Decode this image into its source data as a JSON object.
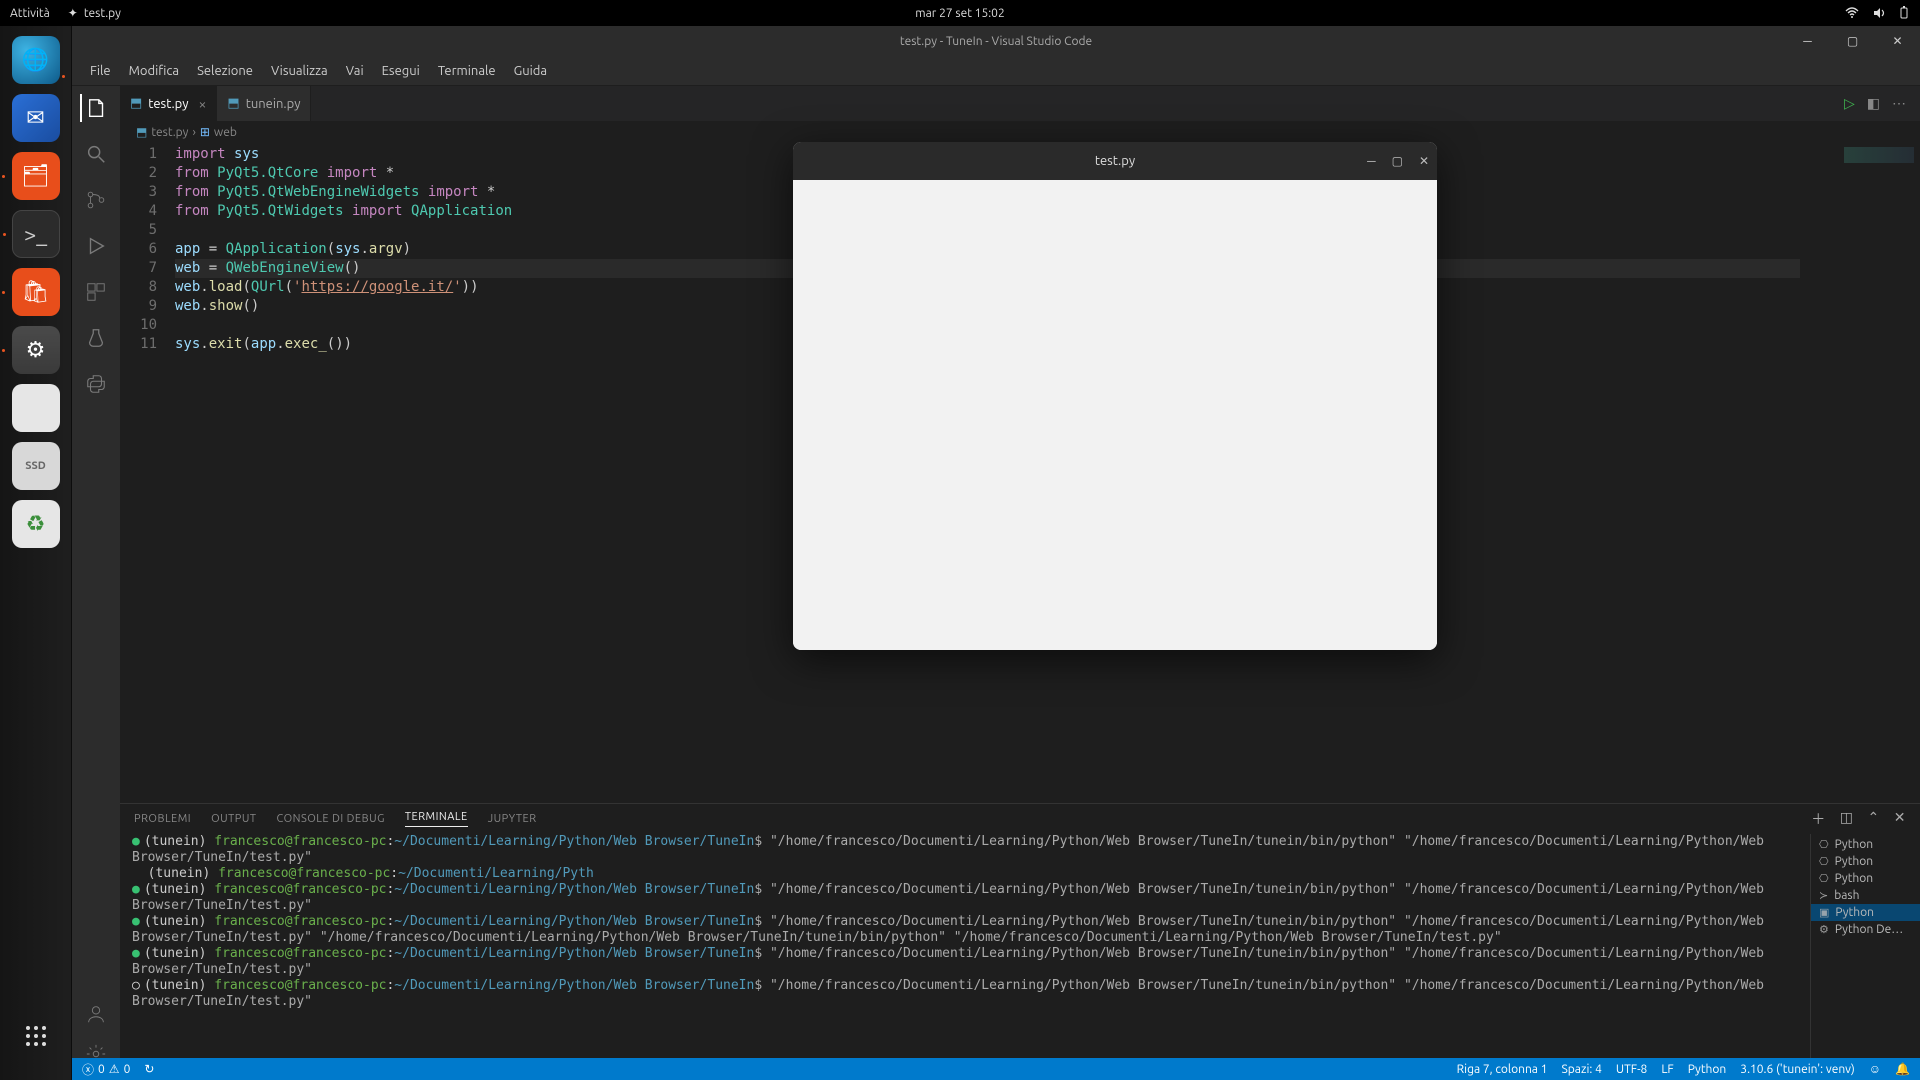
{
  "gnome": {
    "activities": "Attività",
    "task": "test.py",
    "datetime": "mar 27 set  15:02"
  },
  "dock_labels": {
    "ssd": "SSD"
  },
  "vscode": {
    "title": "test.py - TuneIn - Visual Studio Code",
    "menu": [
      "File",
      "Modifica",
      "Selezione",
      "Visualizza",
      "Vai",
      "Esegui",
      "Terminale",
      "Guida"
    ],
    "tabs": [
      {
        "label": "test.py",
        "active": true
      },
      {
        "label": "tunein.py",
        "active": false
      }
    ],
    "breadcrumb": {
      "file": "test.py",
      "symbol": "web"
    },
    "active_line": 7,
    "code": [
      {
        "n": 1,
        "raw": "import sys"
      },
      {
        "n": 2,
        "raw": "from PyQt5.QtCore import *"
      },
      {
        "n": 3,
        "raw": "from PyQt5.QtWebEngineWidgets import *"
      },
      {
        "n": 4,
        "raw": "from PyQt5.QtWidgets import QApplication"
      },
      {
        "n": 5,
        "raw": ""
      },
      {
        "n": 6,
        "raw": "app = QApplication(sys.argv)"
      },
      {
        "n": 7,
        "raw": "web = QWebEngineView()"
      },
      {
        "n": 8,
        "raw": "web.load(QUrl('https://google.it/'))"
      },
      {
        "n": 9,
        "raw": "web.show()"
      },
      {
        "n": 10,
        "raw": ""
      },
      {
        "n": 11,
        "raw": "sys.exit(app.exec_())"
      }
    ],
    "panel": {
      "tabs": [
        "PROBLEMI",
        "OUTPUT",
        "CONSOLE DI DEBUG",
        "TERMINALE",
        "JUPYTER"
      ],
      "active_tab": "TERMINALE",
      "terminal_sessions": [
        {
          "label": "Python",
          "icon": "snake"
        },
        {
          "label": "Python",
          "icon": "snake"
        },
        {
          "label": "Python",
          "icon": "snake"
        },
        {
          "label": "bash",
          "icon": "bash"
        },
        {
          "label": "Python",
          "icon": "term",
          "active": true
        },
        {
          "label": "Python De…",
          "icon": "gear"
        }
      ],
      "terminal_lines": [
        {
          "bullet": "green",
          "prefix": "(tunein) ",
          "user": "francesco@francesco-pc",
          "path": "~/Documenti/Learning/Python/Web Browser/TuneIn",
          "cmd": "$ \"/home/francesco/Documenti/Learning/Python/Web Browser/TuneIn/tunein/bin/python\" \"/home/francesco/Documenti/Learning/Python/Web Browser/TuneIn/test.py\""
        },
        {
          "bullet": "",
          "prefix": "(tunein) ",
          "user": "francesco@francesco-pc",
          "path": "~/Documenti/Learning/Pyth",
          "cmd": ""
        },
        {
          "bullet": "green",
          "prefix": "(tunein) ",
          "user": "francesco@francesco-pc",
          "path": "~/Documenti/Learning/Python/Web Browser/TuneIn",
          "cmd": "$ \"/home/francesco/Documenti/Learning/Python/Web Browser/TuneIn/tunein/bin/python\" \"/home/francesco/Documenti/Learning/Python/Web Browser/TuneIn/test.py\""
        },
        {
          "bullet": "green",
          "prefix": "(tunein) ",
          "user": "francesco@francesco-pc",
          "path": "~/Documenti/Learning/Python/Web Browser/TuneIn",
          "cmd": "$ \"/home/francesco/Documenti/Learning/Python/Web Browser/TuneIn/tunein/bin/python\" \"/home/francesco/Documenti/Learning/Python/Web Browser/TuneIn/test.py\" \"/home/francesco/Documenti/Learning/Python/Web Browser/TuneIn/tunein/bin/python\" \"/home/francesco/Documenti/Learning/Python/Web Browser/TuneIn/test.py\""
        },
        {
          "bullet": "green",
          "prefix": "(tunein) ",
          "user": "francesco@francesco-pc",
          "path": "~/Documenti/Learning/Python/Web Browser/TuneIn",
          "cmd": "$ \"/home/francesco/Documenti/Learning/Python/Web Browser/TuneIn/tunein/bin/python\" \"/home/francesco/Documenti/Learning/Python/Web Browser/TuneIn/test.py\""
        },
        {
          "bullet": "white",
          "prefix": "(tunein) ",
          "user": "francesco@francesco-pc",
          "path": "~/Documenti/Learning/Python/Web Browser/TuneIn",
          "cmd": "$ \"/home/francesco/Documenti/Learning/Python/Web Browser/TuneIn/tunein/bin/python\" \"/home/francesco/Documenti/Learning/Python/Web Browser/TuneIn/test.py\""
        }
      ]
    },
    "status": {
      "errors": "0",
      "warnings": "0",
      "cursor": "Riga 7, colonna 1",
      "spaces": "Spazi: 4",
      "encoding": "UTF-8",
      "eol": "LF",
      "lang": "Python",
      "interpreter": "3.10.6 ('tunein': venv)"
    }
  },
  "child_window": {
    "title": "test.py"
  }
}
